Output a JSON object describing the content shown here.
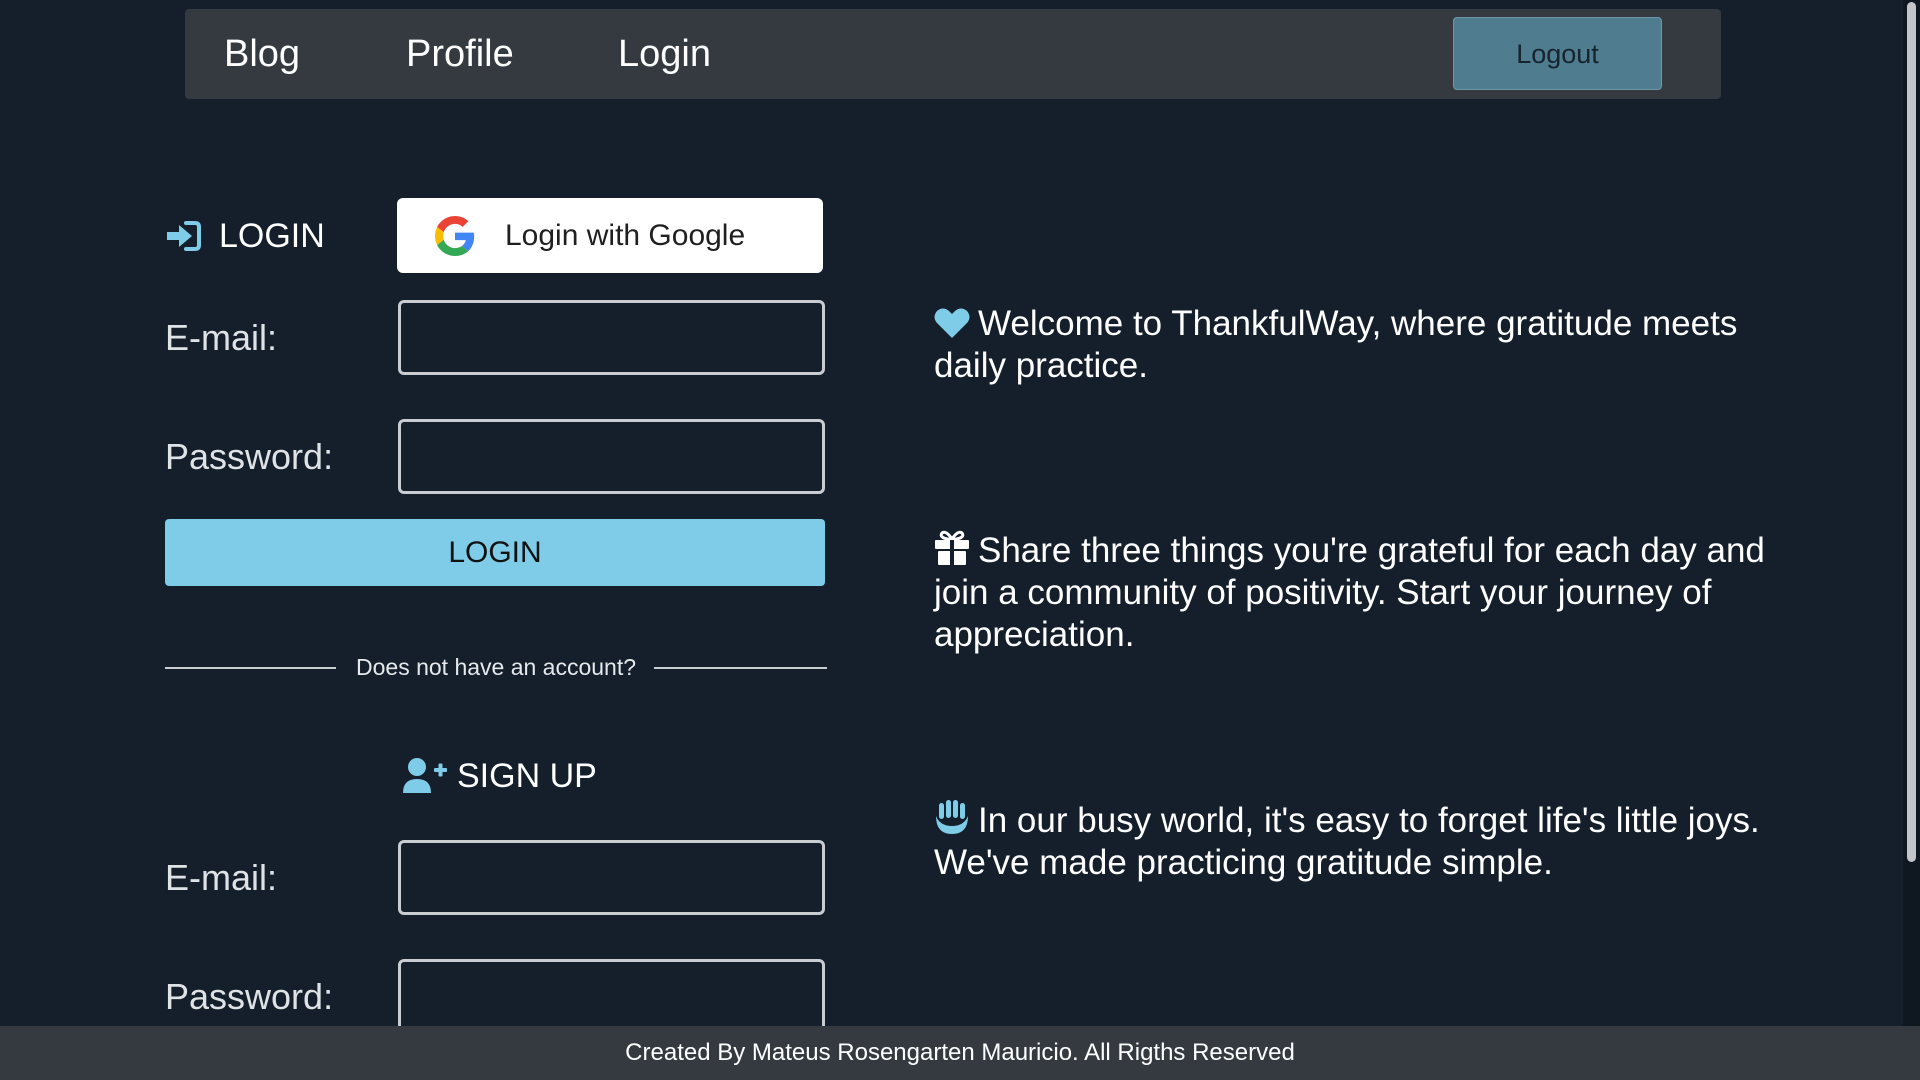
{
  "nav": {
    "links": [
      "Blog",
      "Profile",
      "Login"
    ],
    "logout_label": "Logout"
  },
  "login": {
    "heading": "LOGIN",
    "google_label": "Login with Google",
    "email_label": "E-mail:",
    "password_label": "Password:",
    "email_value": "",
    "password_value": "",
    "submit_label": "LOGIN"
  },
  "divider_text": "Does not have an account?",
  "signup": {
    "heading": "SIGN UP",
    "email_label": "E-mail:",
    "password_label": "Password:",
    "email_value": "",
    "password_value": ""
  },
  "info": [
    {
      "icon": "heart-icon",
      "text": "Welcome to ThankfulWay, where gratitude meets daily practice."
    },
    {
      "icon": "gift-icon",
      "text": "Share three things you're grateful for each day and join a community of positivity. Start your journey of appreciation."
    },
    {
      "icon": "hands-icon",
      "text": "In our busy world, it's easy to forget life's little joys. We've made practicing gratitude simple."
    }
  ],
  "footer_text": "Created By Mateus Rosengarten Mauricio. All Rigths Reserved",
  "colors": {
    "background": "#141f2b",
    "navbar": "#343a40",
    "accent": "#7ecce8",
    "logout_button": "#4f7c8f"
  }
}
